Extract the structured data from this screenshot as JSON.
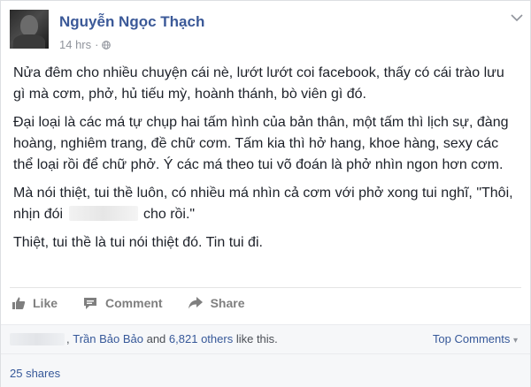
{
  "post": {
    "author": "Nguyễn Ngọc Thạch",
    "time": "14 hrs",
    "separator": "·",
    "paragraphs": {
      "p1": "Nửa đêm cho nhiều chuyện cái nè, lướt lướt coi facebook, thấy có cái trào lưu gì mà cơm, phở, hủ tiếu mỳ, hoành thánh, bò viên gì đó.",
      "p2": "Đại loại là các má tự chụp hai tấm hình của bản thân, một tấm thì lịch sự, đàng hoàng, nghiêm trang, đề chữ cơm. Tấm kia thì hở hang, khoe hàng, sexy các thể loại rồi để chữ phở. Ý các má theo tui võ đoán là phở nhìn ngon hơn cơm.",
      "p3_start": "Mà nói thiệt, tui thề luôn, có nhiều má nhìn cả cơm với phở xong tui nghĩ, \"Thôi, nhịn đói",
      "p3_end": "cho rồi.\"",
      "p4": "Thiệt, tui thề là tui nói thiệt đó. Tin tui đi."
    }
  },
  "actions": {
    "like": "Like",
    "comment": "Comment",
    "share": "Share"
  },
  "reactions": {
    "liker_name": "Trần Bảo Bảo",
    "and_text": "and",
    "others": "6,821 others",
    "like_this": "like this.",
    "top_comments": "Top Comments",
    "top_comments_caret": "▾"
  },
  "shares": "25 shares",
  "colors": {
    "link": "#3b5998",
    "text": "#1d2129",
    "muted": "#90949c",
    "action": "#7f7f7f"
  }
}
